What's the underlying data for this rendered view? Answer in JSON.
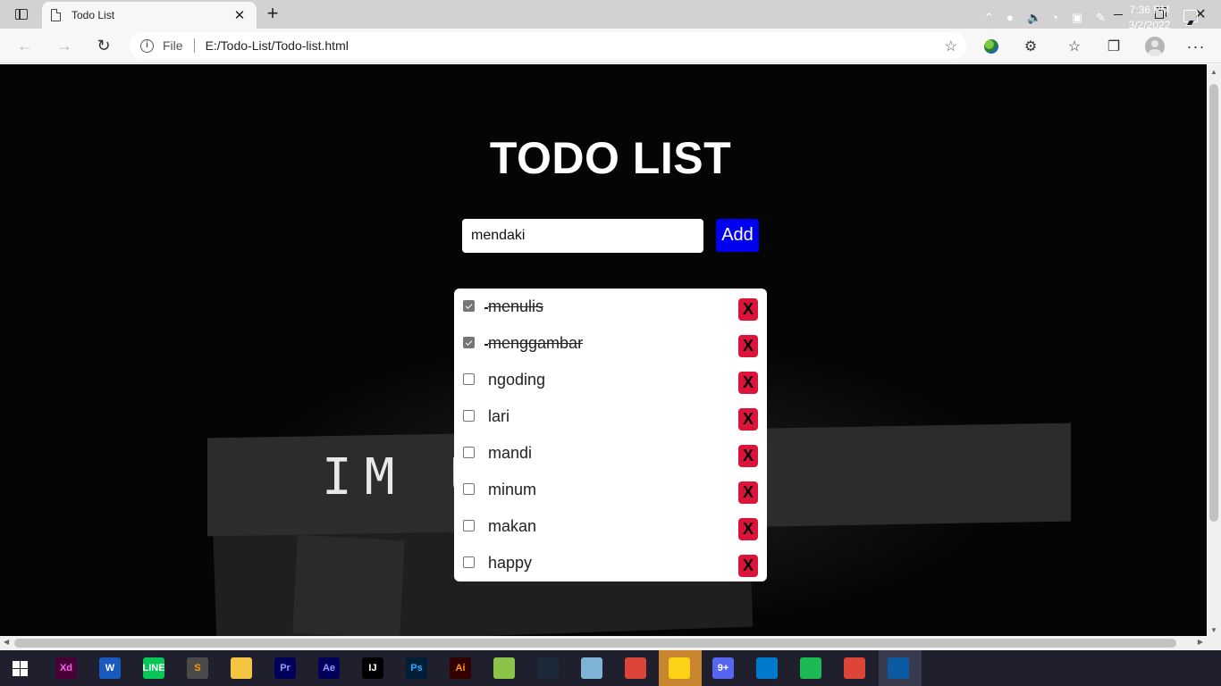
{
  "browser": {
    "tab_title": "Todo List",
    "tab_close": "✕",
    "new_tab": "+",
    "omnibox": {
      "scheme_label": "File",
      "url": "E:/Todo-List/Todo-list.html"
    },
    "toolbar_icons": [
      "extension-globe-icon",
      "extensions-icon",
      "favorites-icon",
      "collections-icon",
      "profile-icon",
      "more-icon"
    ]
  },
  "page": {
    "title": "TODO LIST",
    "input": {
      "value": "mendaki",
      "placeholder": ""
    },
    "add_button_label": "Add",
    "background_text": "IM U     YSELF",
    "todos": [
      {
        "text": "menulis",
        "done": true
      },
      {
        "text": "menggambar",
        "done": true
      },
      {
        "text": "ngoding",
        "done": false
      },
      {
        "text": "lari",
        "done": false
      },
      {
        "text": "mandi",
        "done": false
      },
      {
        "text": "minum",
        "done": false
      },
      {
        "text": "makan",
        "done": false
      },
      {
        "text": "happy",
        "done": false
      }
    ],
    "delete_label": "X",
    "colors": {
      "add_button": "#0000ee",
      "delete_button": "#dc143c",
      "title": "#ffffff"
    }
  },
  "taskbar": {
    "apps": [
      {
        "name": "adobe-xd-icon",
        "label": "Xd",
        "bg": "#470137",
        "fg": "#ff61f6"
      },
      {
        "name": "word-icon",
        "label": "W",
        "bg": "#185abd",
        "fg": "#ffffff"
      },
      {
        "name": "line-icon",
        "label": "LINE",
        "bg": "#06c755",
        "fg": "#ffffff"
      },
      {
        "name": "sublime-icon",
        "label": "S",
        "bg": "#4a4a4a",
        "fg": "#ff9800"
      },
      {
        "name": "file-explorer-icon",
        "label": "",
        "bg": "#f4c542",
        "fg": "#ffffff"
      },
      {
        "name": "premiere-icon",
        "label": "Pr",
        "bg": "#00005b",
        "fg": "#9999ff"
      },
      {
        "name": "after-effects-icon",
        "label": "Ae",
        "bg": "#00005b",
        "fg": "#9999ff"
      },
      {
        "name": "intellij-icon",
        "label": "IJ",
        "bg": "#000000",
        "fg": "#ffffff"
      },
      {
        "name": "photoshop-icon",
        "label": "Ps",
        "bg": "#001e36",
        "fg": "#31a8ff"
      },
      {
        "name": "illustrator-icon",
        "label": "Ai",
        "bg": "#330000",
        "fg": "#ff9a00"
      },
      {
        "name": "notepad-plus-icon",
        "label": "",
        "bg": "#8bc34a",
        "fg": "#ffffff"
      },
      {
        "name": "steam-icon",
        "label": "",
        "bg": "#1b2838",
        "fg": "#ffffff"
      },
      {
        "name": "app-icon",
        "label": "",
        "bg": "#7fb3d5",
        "fg": "#ffffff"
      },
      {
        "name": "chrome-icon",
        "label": "",
        "bg": "#db4437",
        "fg": "#ffffff"
      },
      {
        "name": "sticky-notes-icon",
        "label": "",
        "bg": "#fcd116",
        "fg": "#000000"
      },
      {
        "name": "discord-icon",
        "label": "9+",
        "bg": "#5865f2",
        "fg": "#ffffff"
      },
      {
        "name": "vscode-icon",
        "label": "",
        "bg": "#007acc",
        "fg": "#ffffff"
      },
      {
        "name": "spotify-icon",
        "label": "",
        "bg": "#1db954",
        "fg": "#000000"
      },
      {
        "name": "chrome-icon-2",
        "label": "",
        "bg": "#db4437",
        "fg": "#ffffff"
      },
      {
        "name": "edge-icon",
        "label": "",
        "bg": "#0c59a4",
        "fg": "#34c759"
      }
    ],
    "time": "7:36 PM",
    "date": "3/2/2022"
  }
}
